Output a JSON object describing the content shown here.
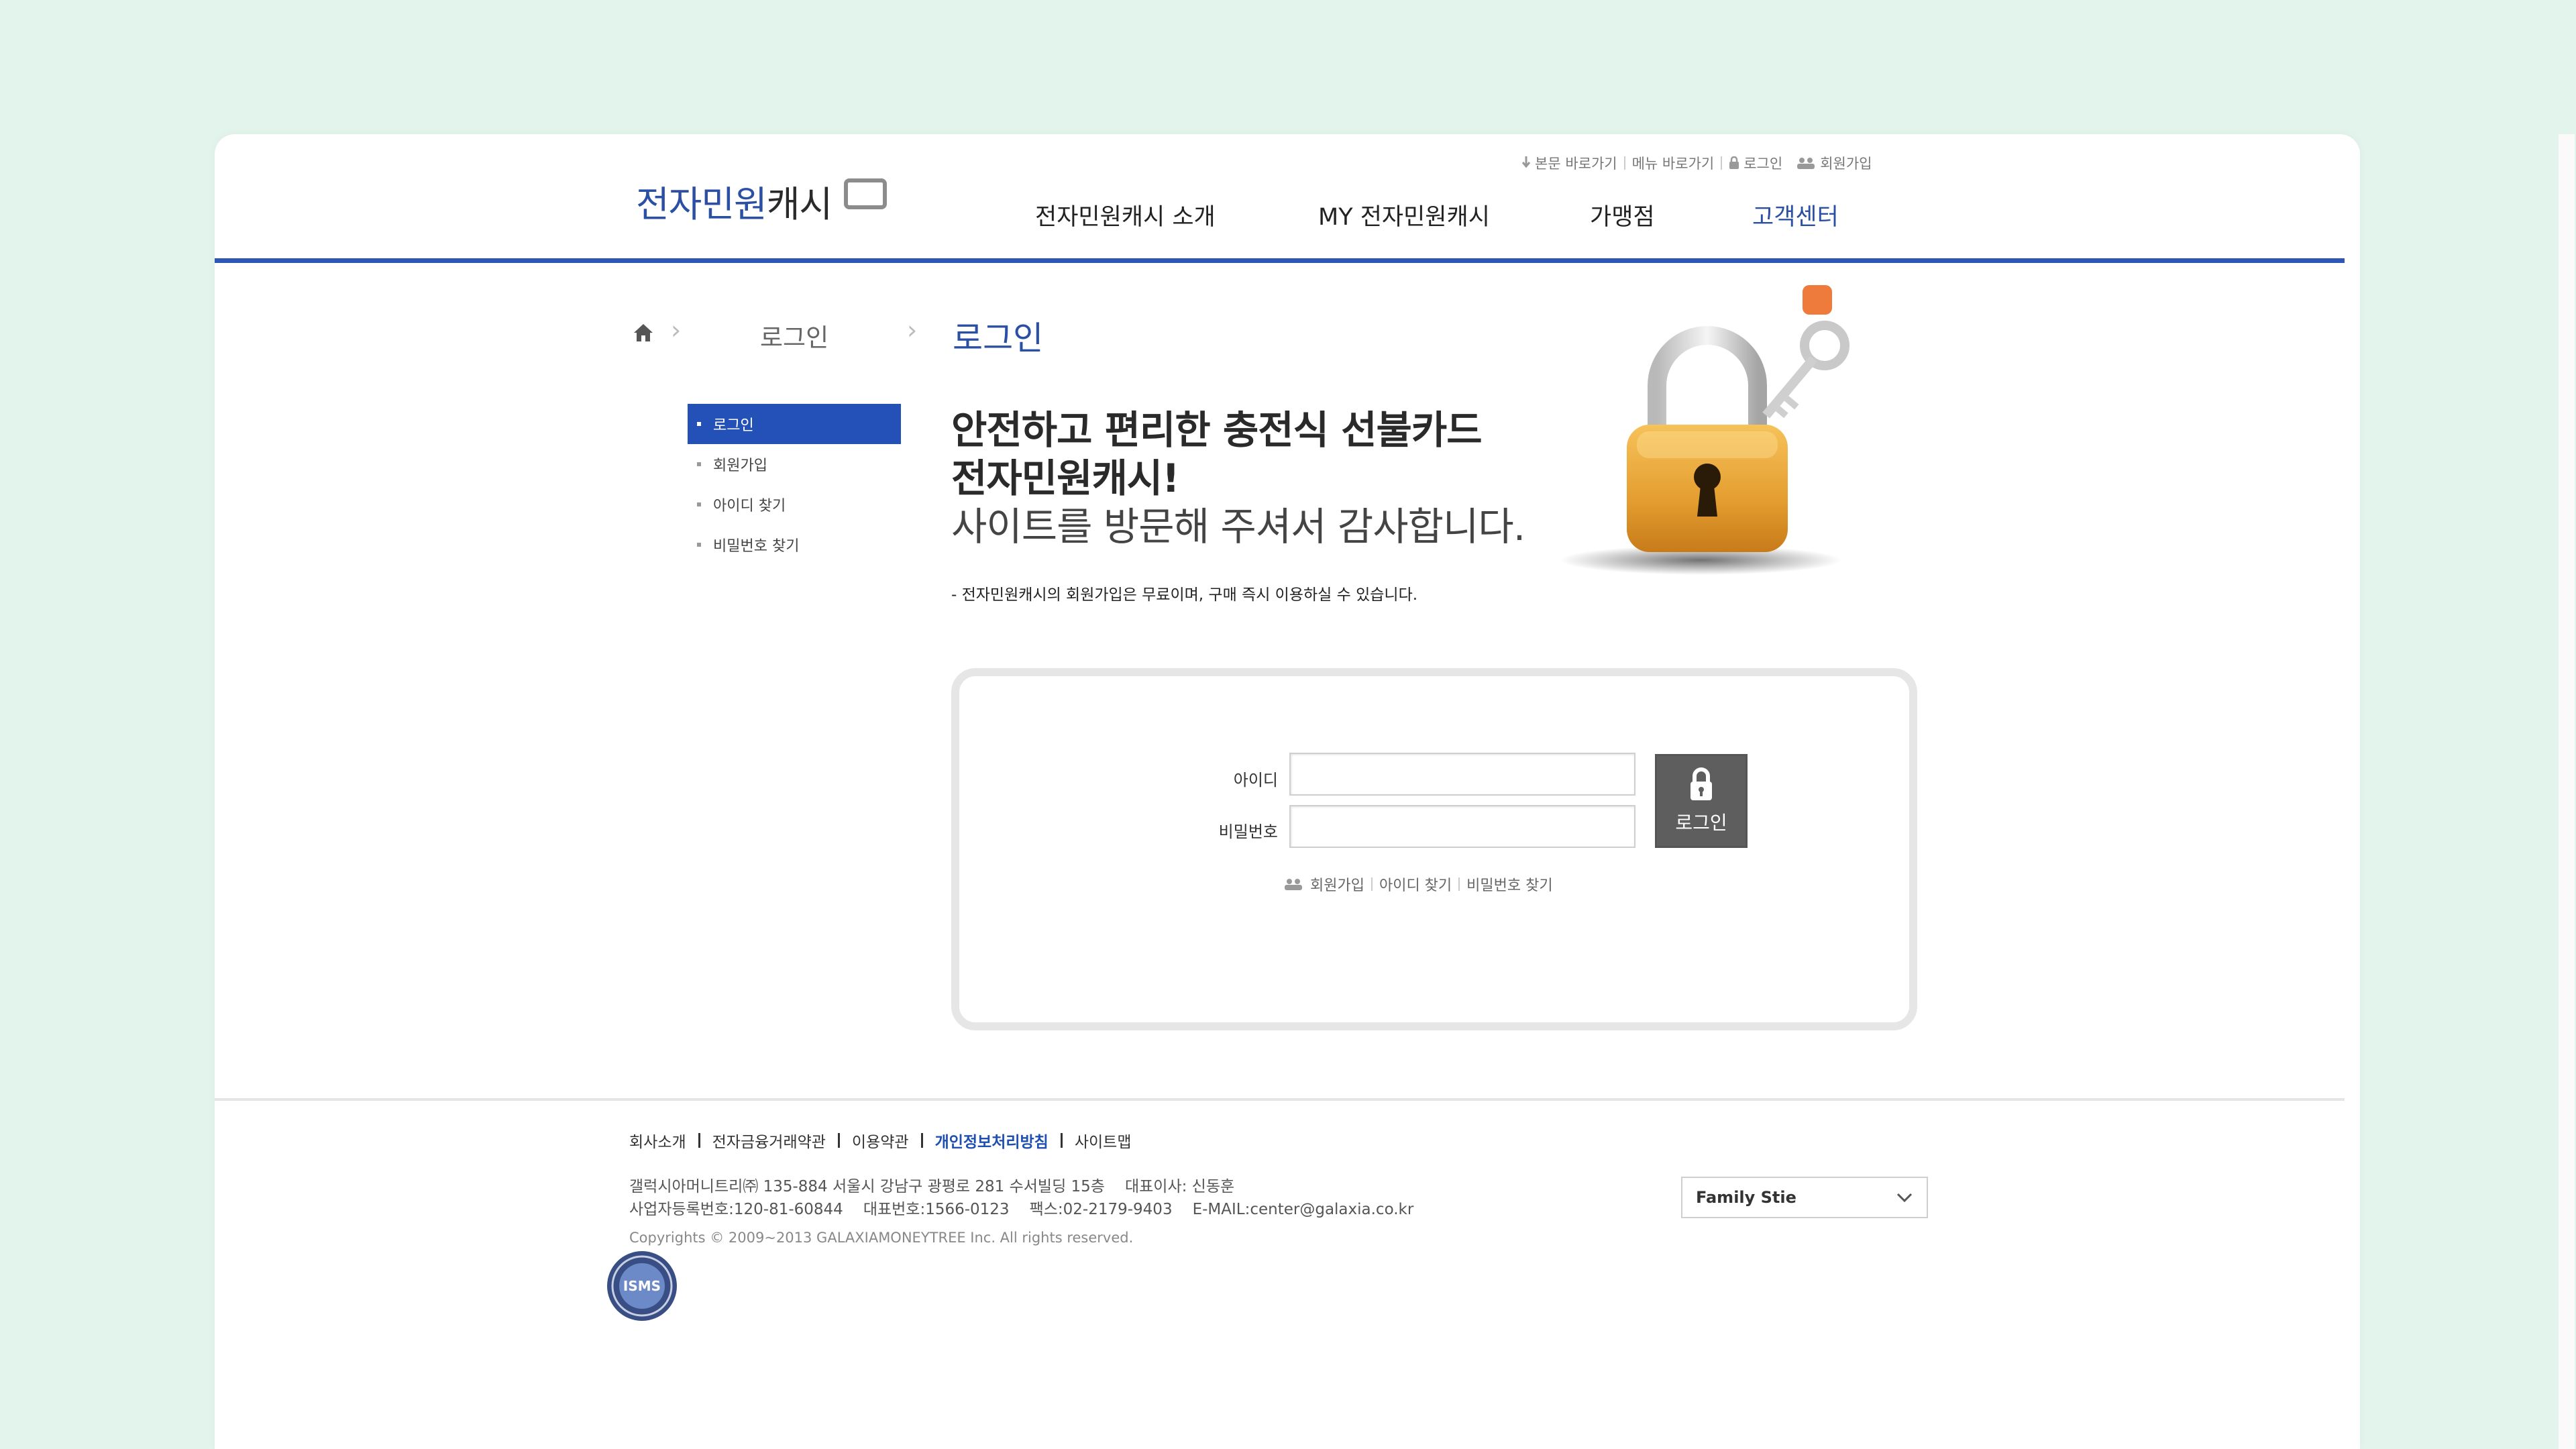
{
  "header": {
    "util_links": [
      {
        "label": "본문 바로가기",
        "icon": "download-arrow-icon"
      },
      {
        "label": "메뉴 바로가기"
      },
      {
        "label": "로그인",
        "icon": "lock-icon"
      },
      {
        "label": "회원가입",
        "icon": "users-icon"
      }
    ],
    "logo": {
      "text_blue": "전자민원",
      "text_dark": "캐시"
    },
    "gnb": [
      "전자민원캐시 소개",
      "MY 전자민원캐시",
      "가맹점",
      "고객센터"
    ],
    "gnb_active_index": 3
  },
  "breadcrumb": {
    "home_icon": "home-icon",
    "level1": "로그인",
    "current": "로그인"
  },
  "lnb": {
    "items": [
      "로그인",
      "회원가입",
      "아이디 찾기",
      "비밀번호 찾기"
    ],
    "active_index": 0
  },
  "intro": {
    "line1": "안전하고 편리한 충전식 선불카드",
    "line2": "전자민원캐시!",
    "line3": "사이트를 방문해 주셔서 감사합니다.",
    "note": "- 전자민원캐시의 회원가입은 무료이며, 구매 즉시 이용하실 수 있습니다."
  },
  "login_form": {
    "id_label": "아이디",
    "id_value": "",
    "password_label": "비밀번호",
    "password_value": "",
    "button_label": "로그인",
    "links": [
      "회원가입",
      "아이디 찾기",
      "비밀번호 찾기"
    ]
  },
  "footer": {
    "links": [
      "회사소개",
      "전자금융거래약관",
      "이용약관",
      "개인정보처리방침",
      "사이트맵"
    ],
    "address_line1": [
      "갤럭시아머니트리㈜ 135-884 서울시 강남구 광평로 281 수서빌딩 15층",
      "대표이사: 신동훈"
    ],
    "address_line2": [
      "사업자등록번호:120-81-60844",
      "대표번호:1566-0123",
      "팩스:02-2179-9403",
      "E-MAIL:center@galaxia.co.kr"
    ],
    "copyright": "Copyrights © 2009~2013 GALAXIAMONEYTREE Inc. All rights reserved.",
    "family_site": "Family Stie",
    "badge_text": "ISMS"
  },
  "colors": {
    "page_bg": "#e3f4ec",
    "brand_blue": "#2b4fa3",
    "header_line": "#2e56b5",
    "lnb_active": "#2451b8",
    "login_button": "#5e5e5e",
    "lock_gold": "#e9a93a",
    "chat_orange": "#ee7a3b"
  }
}
